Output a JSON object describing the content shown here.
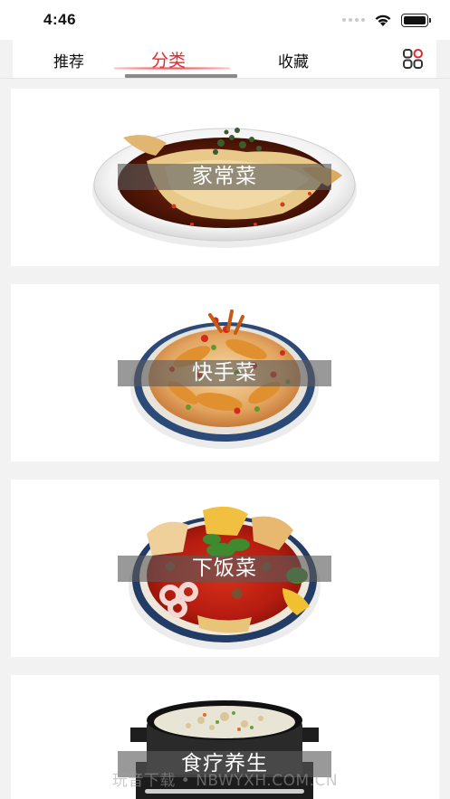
{
  "status_bar": {
    "time": "4:46"
  },
  "tabs": {
    "items": [
      {
        "label": "推荐",
        "active": false
      },
      {
        "label": "分类",
        "active": true
      },
      {
        "label": "收藏",
        "active": false
      }
    ],
    "active_color": "#e8262e",
    "grid_icon": "grid-apps-icon"
  },
  "categories": [
    {
      "label": "家常菜",
      "image": "braised-chicken-dish"
    },
    {
      "label": "快手菜",
      "image": "chili-chicken-feet-dish"
    },
    {
      "label": "下饭菜",
      "image": "spicy-hotpot-dish"
    },
    {
      "label": "食疗养生",
      "image": "clay-pot-soup-dish"
    }
  ],
  "watermark": "玩音下载 • NBWYXH.COM.CN"
}
